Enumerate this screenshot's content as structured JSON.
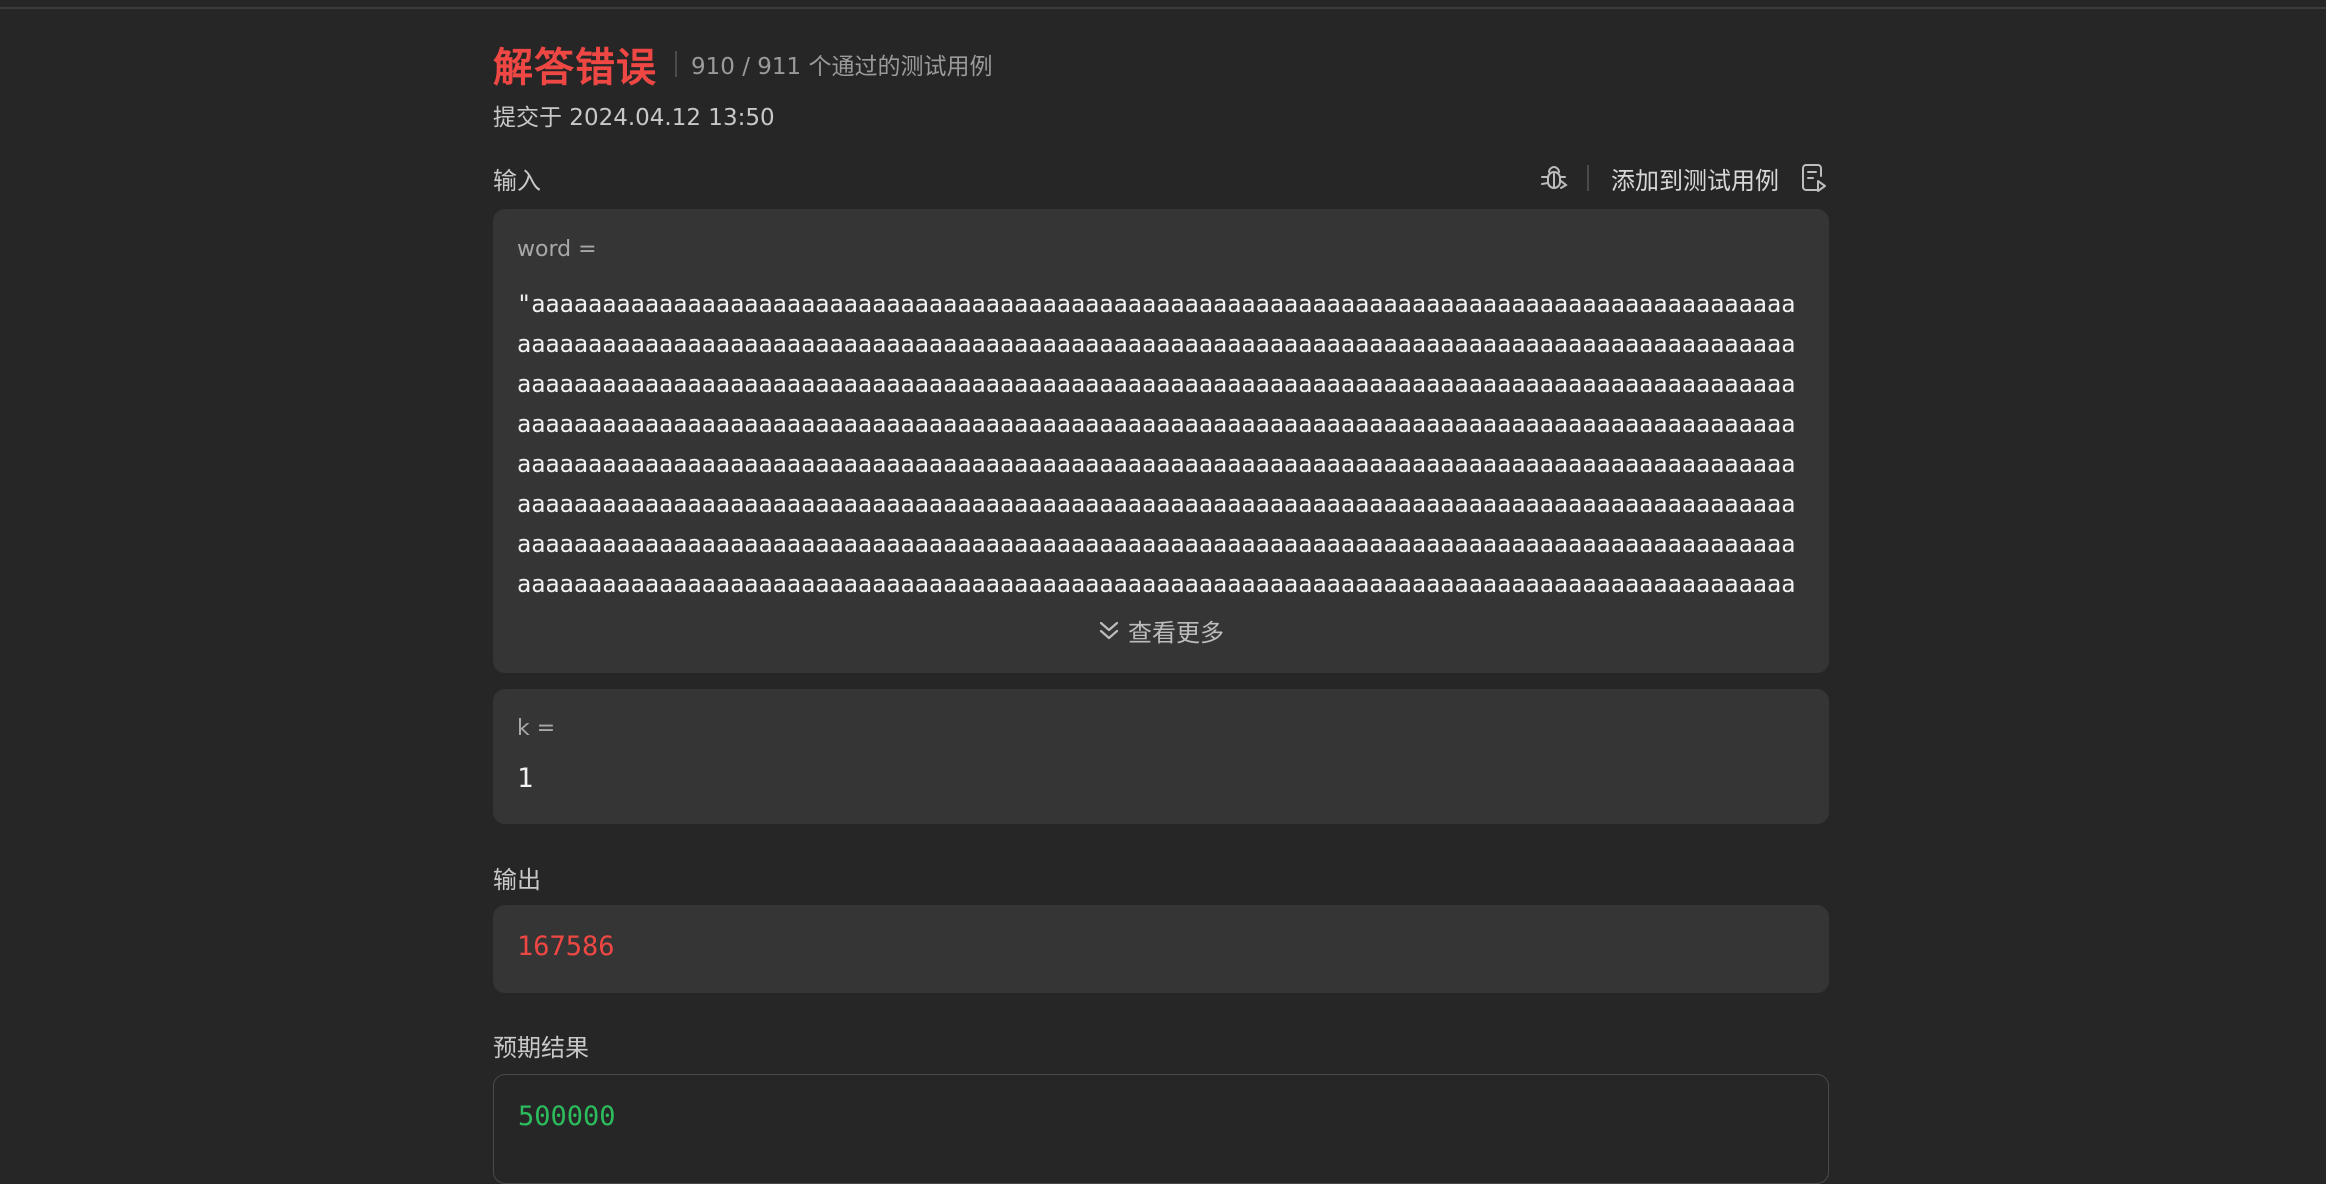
{
  "result": {
    "status": "解答错误",
    "passed_cases": "910 / 911 个通过的测试用例",
    "submitted_at": "提交于 2024.04.12 13:50"
  },
  "input": {
    "label": "输入",
    "add_to_testcase_label": "添加到测试用例",
    "params": [
      {
        "name": "word =",
        "value": "\"aaaaaaaaaaaaaaaaaaaaaaaaaaaaaaaaaaaaaaaaaaaaaaaaaaaaaaaaaaaaaaaaaaaaaaaaaaaaaaaaaaaaaaaaaaaaaaaaaaaaaaaaaaaaaaaaaaaaaaaaaaaaaaaaaaaaaaaaaaaaaaaaaaaaaaaaaaaaaaaaaaaaaaaaaaaaaaaaaaaaaaaaaaaaaaaaaaaaaaaaaaaaaaaaaaaaaaaaaaaaaaaaaaaaaaaaaaaaaaaaaaaaaaaaaaaaaaaaaaaaaaaaaaaaaaaaaaaaaaaaaaaaaaaaaaaaaaaaaaaaaaaaaaaaaaaaaaaaaaaaaaaaaaaaaaaaaaaaaaaaaaaaaaaaaaaaaaaaaaaaaaaaaaaaaaaaaaaaaaaaaaaaaaaaaaaaaaaaaaaaaaaaaaaaaaaaaaaaaaaaaaaaaaaaaaaaaaaaaaaaaaaaaaaaaaaaaaaaaaaaaaaaaaaaaaaaaaaaaaaaaaaaaaaaaaaaaaaaaaaaaaaaaaaaaaaaaaaaaaaaaaaaaaaaaaaaaaaaaaaaaaaaaaaaaaaaaaaaaaaaaaaaaaaaaaaaaaaaaaaaaaaaaaaaaaaaaaaaaaaaaaaaaaaaaaaaaaaaaaaaaaaaaaaaaaaaaaaaaaaaaaaaaaaaaaaaaaaaaaaaaaaaaaaaaaaaaaaaaaaaaaaaaaaaaaaaaaaaaaaaaaaaaaaaaaaaaaaaaaaaaaaaaaaaaaaaaaaaaaaaaaaaaaaaaaaaaaaaaaaaaaaaaaaaaaaaaaaaaaaaaaaaaaaaaaaaaaaaaaaaaaaaaaa"
      },
      {
        "name": "k =",
        "value": "1"
      }
    ],
    "see_more_label": "查看更多"
  },
  "output": {
    "label": "输出",
    "value": "167586",
    "color": "#ef4743"
  },
  "expected": {
    "label": "预期结果",
    "value": "500000",
    "color": "#2cbb5d"
  },
  "icons": {
    "debug": "bug-icon",
    "add_testcase": "add-testcase-icon",
    "see_more": "double-chevron-down-icon"
  }
}
